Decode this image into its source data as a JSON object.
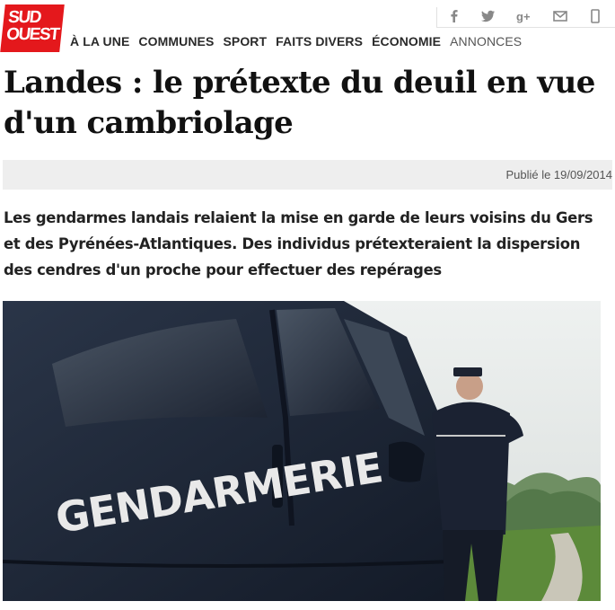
{
  "logo": {
    "line1": "SUD",
    "line2": "OUEST"
  },
  "share": [
    "facebook-icon",
    "twitter-icon",
    "googleplus-icon",
    "mail-icon",
    "mobile-icon"
  ],
  "nav": {
    "items": [
      {
        "label": "À LA UNE"
      },
      {
        "label": "COMMUNES"
      },
      {
        "label": "SPORT"
      },
      {
        "label": "FAITS DIVERS"
      },
      {
        "label": "ÉCONOMIE"
      },
      {
        "label": "ANNONCES"
      }
    ]
  },
  "article": {
    "title": "Landes : le prétexte du deuil en vue d'un cambriolage",
    "published": "Publié le 19/09/2014",
    "lede": "Les gendarmes landais relaient la mise en garde de leurs voisins du Gers et des Pyrénées-Atlantiques. Des individus prétexteraient la dispersion des cendres d'un proche pour effectuer des repérages",
    "photo_text": "GENDARMERIE"
  },
  "colors": {
    "brand": "#e4181c",
    "van": "#1c2536",
    "grass": "#5c8a3a"
  }
}
